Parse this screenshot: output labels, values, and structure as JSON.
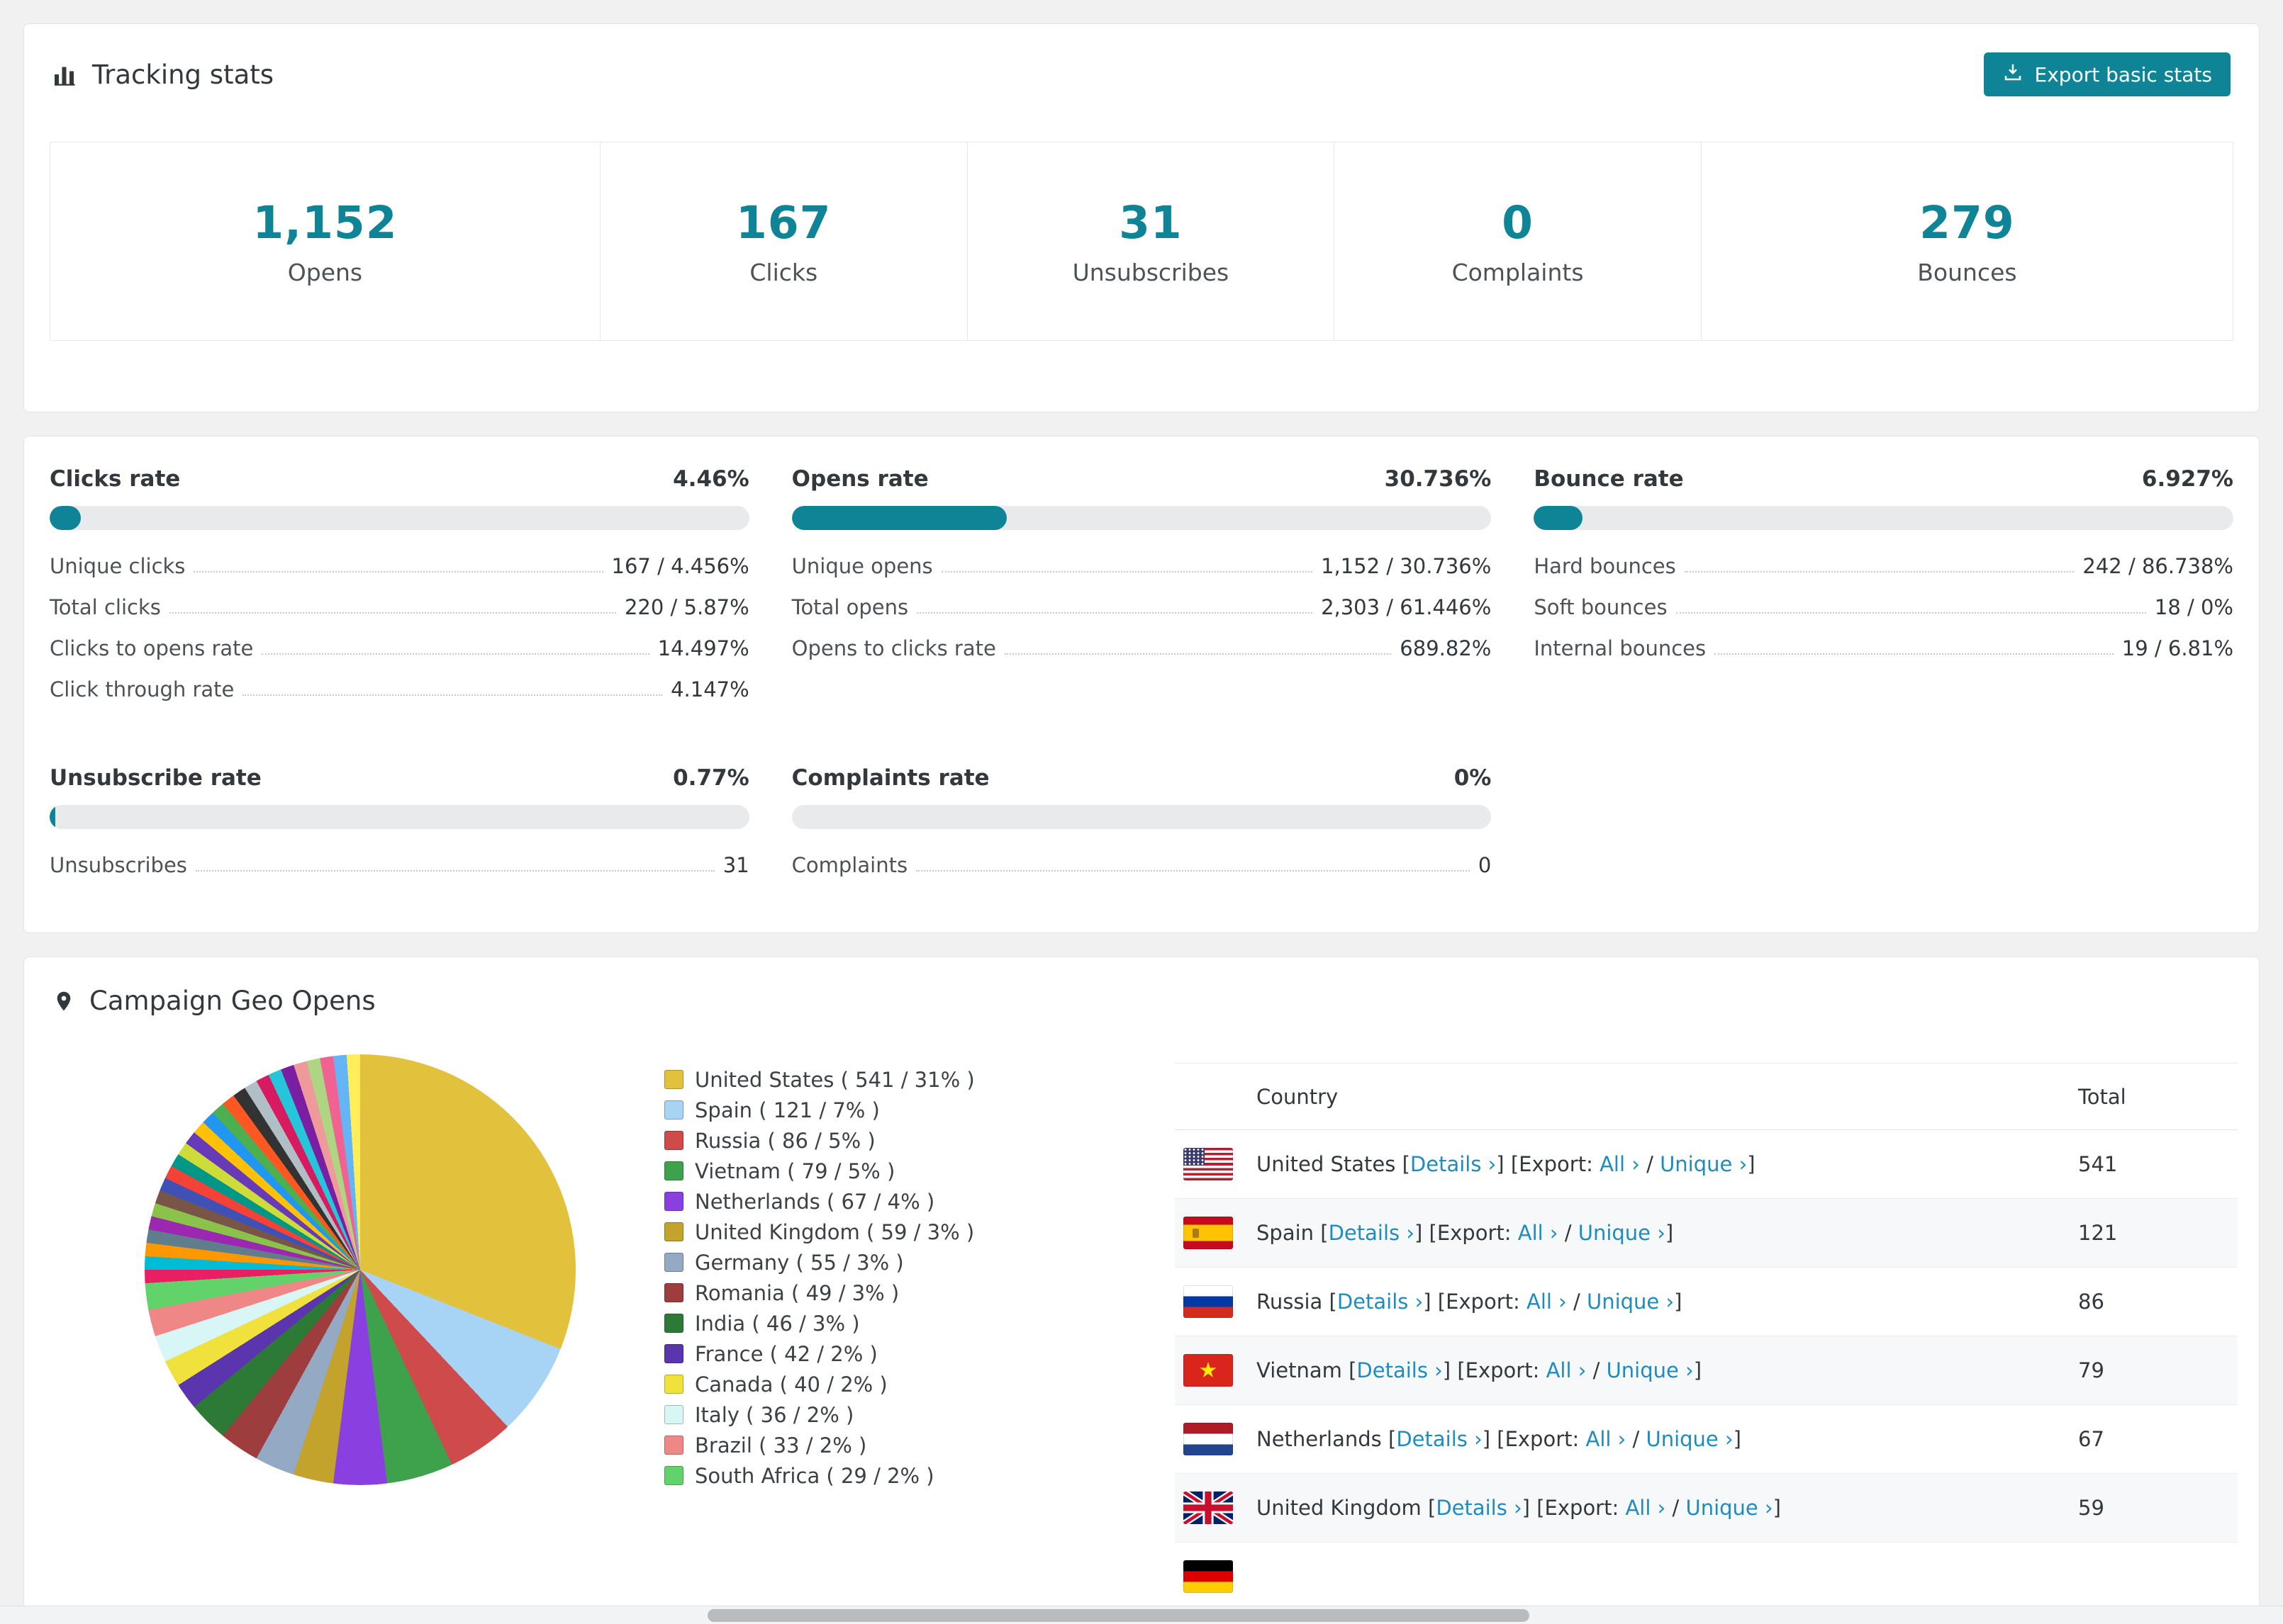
{
  "colors": {
    "accent": "#0f8496",
    "link": "#1e8cbe",
    "bar_track": "#e9eaec"
  },
  "tracking": {
    "title": "Tracking stats",
    "export_button": "Export basic stats",
    "stats": [
      {
        "value": "1,152",
        "label": "Opens"
      },
      {
        "value": "167",
        "label": "Clicks"
      },
      {
        "value": "31",
        "label": "Unsubscribes"
      },
      {
        "value": "0",
        "label": "Complaints"
      },
      {
        "value": "279",
        "label": "Bounces"
      }
    ]
  },
  "rates": [
    {
      "title": "Clicks rate",
      "value": "4.46%",
      "percent": 4.46,
      "rows": [
        {
          "label": "Unique clicks",
          "value": "167 / 4.456%"
        },
        {
          "label": "Total clicks",
          "value": "220 / 5.87%"
        },
        {
          "label": "Clicks to opens rate",
          "value": "14.497%"
        },
        {
          "label": "Click through rate",
          "value": "4.147%"
        }
      ]
    },
    {
      "title": "Opens rate",
      "value": "30.736%",
      "percent": 30.736,
      "rows": [
        {
          "label": "Unique opens",
          "value": "1,152 / 30.736%"
        },
        {
          "label": "Total opens",
          "value": "2,303 / 61.446%"
        },
        {
          "label": "Opens to clicks rate",
          "value": "689.82%"
        }
      ]
    },
    {
      "title": "Bounce rate",
      "value": "6.927%",
      "percent": 6.927,
      "rows": [
        {
          "label": "Hard bounces",
          "value": "242 / 86.738%"
        },
        {
          "label": "Soft bounces",
          "value": "18 / 0%"
        },
        {
          "label": "Internal bounces",
          "value": "19 / 6.81%"
        }
      ]
    },
    {
      "title": "Unsubscribe rate",
      "value": "0.77%",
      "percent": 0.77,
      "rows": [
        {
          "label": "Unsubscribes",
          "value": "31"
        }
      ]
    },
    {
      "title": "Complaints rate",
      "value": "0%",
      "percent": 0,
      "rows": [
        {
          "label": "Complaints",
          "value": "0"
        }
      ]
    }
  ],
  "geo": {
    "title": "Campaign Geo Opens",
    "table": {
      "country_header": "Country",
      "total_header": "Total",
      "link_labels": {
        "details": "Details ›",
        "export": "Export:",
        "all": "All ›",
        "unique": "Unique ›"
      },
      "punct": {
        "open": "[",
        "close": "]",
        "separator": "/"
      },
      "rows": [
        {
          "country": "United States",
          "flag": "us",
          "total": "541"
        },
        {
          "country": "Spain",
          "flag": "es",
          "total": "121"
        },
        {
          "country": "Russia",
          "flag": "ru",
          "total": "86"
        },
        {
          "country": "Vietnam",
          "flag": "vn",
          "total": "79"
        },
        {
          "country": "Netherlands",
          "flag": "nl",
          "total": "67"
        },
        {
          "country": "United Kingdom",
          "flag": "gb",
          "total": "59"
        },
        {
          "country": "",
          "flag": "de",
          "total": "",
          "partial": true
        }
      ]
    }
  },
  "chart_data": {
    "type": "pie",
    "title": "Campaign Geo Opens",
    "legend_position": "right",
    "slices": [
      {
        "label": "United States",
        "value": 541,
        "percent": 31,
        "color": "#e2c23d"
      },
      {
        "label": "Spain",
        "value": 121,
        "percent": 7,
        "color": "#a7d3f4"
      },
      {
        "label": "Russia",
        "value": 86,
        "percent": 5,
        "color": "#cf4a4a"
      },
      {
        "label": "Vietnam",
        "value": 79,
        "percent": 5,
        "color": "#3ea24c"
      },
      {
        "label": "Netherlands",
        "value": 67,
        "percent": 4,
        "color": "#8a3fe0"
      },
      {
        "label": "United Kingdom",
        "value": 59,
        "percent": 3,
        "color": "#c3a32b"
      },
      {
        "label": "Germany",
        "value": 55,
        "percent": 3,
        "color": "#93a9c4"
      },
      {
        "label": "Romania",
        "value": 49,
        "percent": 3,
        "color": "#9e3d3d"
      },
      {
        "label": "India",
        "value": 46,
        "percent": 3,
        "color": "#2c7a36"
      },
      {
        "label": "France",
        "value": 42,
        "percent": 2,
        "color": "#5b35ad"
      },
      {
        "label": "Canada",
        "value": 40,
        "percent": 2,
        "color": "#f0e13c"
      },
      {
        "label": "Italy",
        "value": 36,
        "percent": 2,
        "color": "#d9f6f6"
      },
      {
        "label": "Brazil",
        "value": 33,
        "percent": 2,
        "color": "#ef8787"
      },
      {
        "label": "South Africa",
        "value": 29,
        "percent": 2,
        "color": "#61d36a"
      }
    ],
    "other_slices": [
      {
        "percent": 1,
        "color": "#e91e63"
      },
      {
        "percent": 1,
        "color": "#00bcd4"
      },
      {
        "percent": 1,
        "color": "#ff9800"
      },
      {
        "percent": 1,
        "color": "#607d8b"
      },
      {
        "percent": 1,
        "color": "#9c27b0"
      },
      {
        "percent": 1,
        "color": "#8bc34a"
      },
      {
        "percent": 1,
        "color": "#795548"
      },
      {
        "percent": 1,
        "color": "#3f51b5"
      },
      {
        "percent": 1,
        "color": "#f44336"
      },
      {
        "percent": 1,
        "color": "#009688"
      },
      {
        "percent": 1,
        "color": "#cddc39"
      },
      {
        "percent": 1,
        "color": "#673ab7"
      },
      {
        "percent": 1,
        "color": "#ffc107"
      },
      {
        "percent": 1,
        "color": "#2196f3"
      },
      {
        "percent": 1,
        "color": "#4caf50"
      },
      {
        "percent": 1,
        "color": "#ff5722"
      },
      {
        "percent": 1,
        "color": "#333333"
      },
      {
        "percent": 1,
        "color": "#b0bec5"
      },
      {
        "percent": 1,
        "color": "#d81b60"
      },
      {
        "percent": 1,
        "color": "#26c6da"
      },
      {
        "percent": 1,
        "color": "#7b1fa2"
      },
      {
        "percent": 1,
        "color": "#ef9a9a"
      },
      {
        "percent": 1,
        "color": "#aed581"
      },
      {
        "percent": 1,
        "color": "#f06292"
      },
      {
        "percent": 1,
        "color": "#64b5f6"
      },
      {
        "percent": 1,
        "color": "#ffee58"
      }
    ]
  }
}
